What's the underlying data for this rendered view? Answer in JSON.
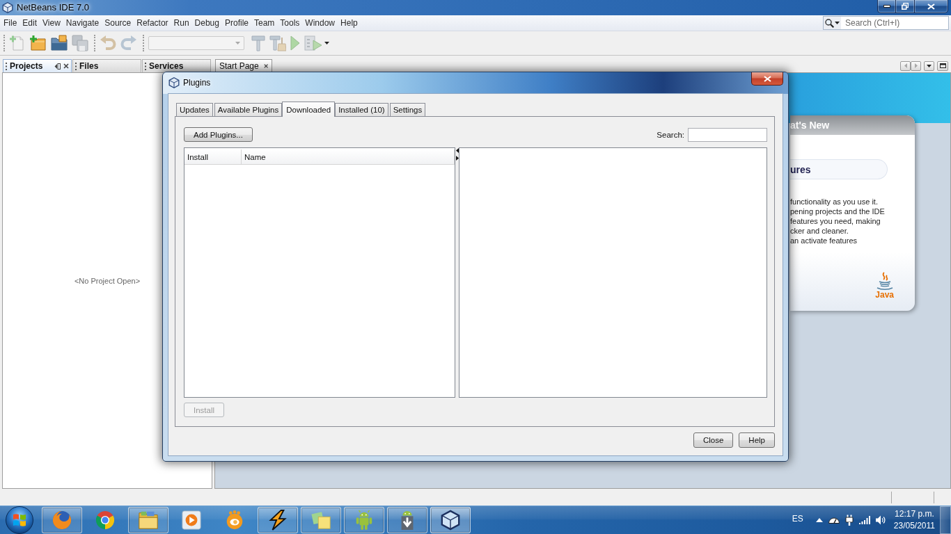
{
  "window": {
    "title": "NetBeans IDE 7.0"
  },
  "menu_bar": [
    "File",
    "Edit",
    "View",
    "Navigate",
    "Source",
    "Refactor",
    "Run",
    "Debug",
    "Profile",
    "Team",
    "Tools",
    "Window",
    "Help"
  ],
  "quick_search": {
    "placeholder": "Search (Ctrl+I)"
  },
  "toolbar": {
    "groups": [
      {
        "buttons": [
          {
            "kind": "file",
            "disabled": true
          },
          {
            "kind": "project",
            "disabled": false
          },
          {
            "kind": "open",
            "disabled": false
          },
          {
            "kind": "save",
            "disabled": true
          }
        ]
      },
      {
        "buttons": [
          {
            "kind": "undo",
            "disabled": true
          },
          {
            "kind": "redo",
            "disabled": true
          }
        ]
      },
      {
        "configuration": {
          "disabled": true
        },
        "buttons": [
          {
            "kind": "build",
            "disabled": true
          },
          {
            "kind": "clean",
            "disabled": true
          },
          {
            "kind": "run",
            "disabled": true
          },
          {
            "kind": "profile",
            "disabled": true
          }
        ]
      }
    ]
  },
  "side_panel": {
    "tabs": [
      {
        "label": "Projects",
        "selected": true
      },
      {
        "label": "Files",
        "selected": false
      },
      {
        "label": "Services",
        "selected": false
      }
    ],
    "message": "<No Project Open>"
  },
  "editor": {
    "tabs": [
      {
        "label": "Start Page",
        "selected": true
      }
    ],
    "start_page": {
      "card_title": "at's New",
      "section_heading": "ures",
      "lines": [
        "functionality as you use it.",
        "pening projects and the IDE",
        "features you need, making",
        "cker and cleaner.",
        "an activate features"
      ],
      "logo_text": "Java"
    }
  },
  "dialog": {
    "title": "Plugins",
    "tabs": [
      {
        "label": "Updates",
        "selected": false
      },
      {
        "label": "Available Plugins",
        "selected": false
      },
      {
        "label": "Downloaded",
        "selected": true
      },
      {
        "label": "Installed (10)",
        "selected": false
      },
      {
        "label": "Settings",
        "selected": false
      }
    ],
    "add_button": "Add Plugins...",
    "search_label": "Search:",
    "table": {
      "columns": [
        "Install",
        "Name"
      ]
    },
    "install_button": {
      "label": "Install",
      "disabled": true
    },
    "buttons": [
      "Close",
      "Help"
    ]
  },
  "taskbar": {
    "apps": [
      {
        "kind": "globe",
        "running": true,
        "selected": false
      },
      {
        "kind": "wheel",
        "running": false,
        "selected": false
      },
      {
        "kind": "folder",
        "running": true,
        "selected": false
      },
      {
        "kind": "media",
        "running": false,
        "selected": false
      },
      {
        "kind": "ball",
        "running": false,
        "selected": false
      },
      {
        "kind": "bolt",
        "running": true,
        "selected": false
      },
      {
        "kind": "notes",
        "running": true,
        "selected": false
      },
      {
        "kind": "robot",
        "running": true,
        "selected": false
      },
      {
        "kind": "download",
        "running": true,
        "selected": false
      },
      {
        "kind": "cube",
        "running": true,
        "selected": true
      }
    ],
    "language": "ES",
    "clock": {
      "time": "12:17 p.m.",
      "date": "23/05/2011"
    }
  }
}
